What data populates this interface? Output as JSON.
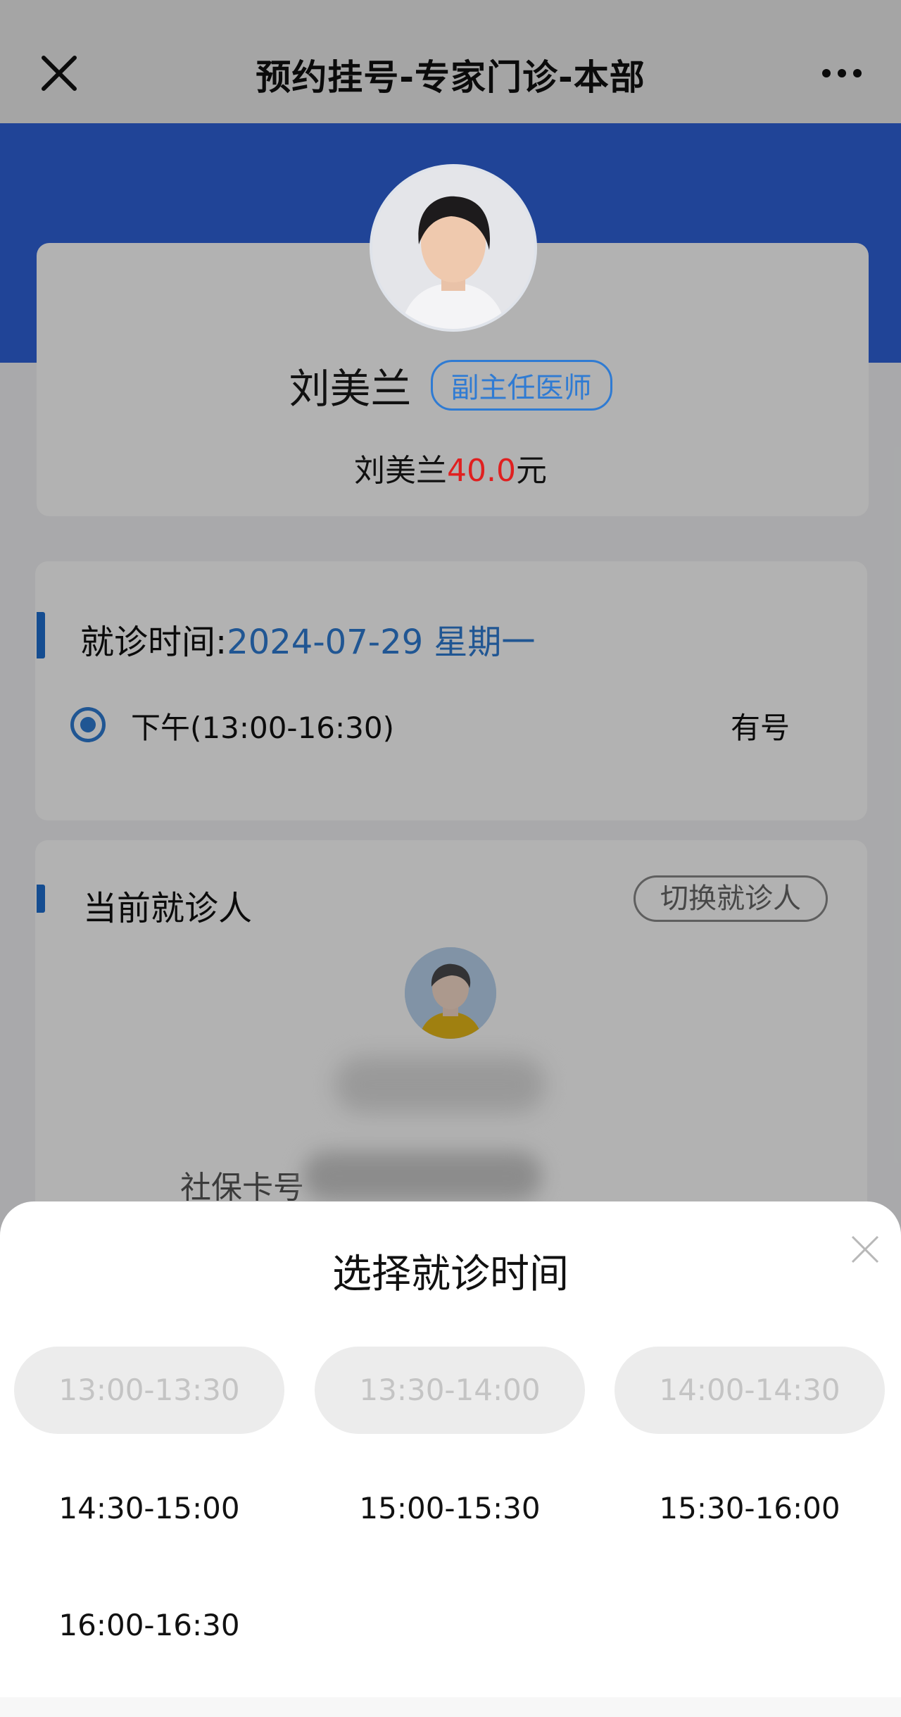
{
  "header": {
    "title": "预约挂号-专家门诊-本部",
    "close_icon": "close-icon",
    "more_icon": "more-icon"
  },
  "doctor": {
    "name": "刘美兰",
    "title": "副主任医师",
    "fee_prefix": "刘美兰",
    "fee_amount": "40.0",
    "fee_unit": "元"
  },
  "visit": {
    "label": "就诊时间:",
    "date": "2024-07-29 星期一",
    "slot": "下午(13:00-16:30)",
    "slot_status": "有号"
  },
  "patient": {
    "label": "当前就诊人",
    "switch_label": "切换就诊人",
    "card_label": "社保卡号"
  },
  "sheet": {
    "title": "选择就诊时间",
    "slots": [
      {
        "label": "13:00-13:30",
        "disabled": true
      },
      {
        "label": "13:30-14:00",
        "disabled": true
      },
      {
        "label": "14:00-14:30",
        "disabled": true
      },
      {
        "label": "14:30-15:00",
        "disabled": false
      },
      {
        "label": "15:00-15:30",
        "disabled": false
      },
      {
        "label": "15:30-16:00",
        "disabled": false
      },
      {
        "label": "16:00-16:30",
        "disabled": false
      }
    ]
  },
  "colors": {
    "accent": "#2f7bd3",
    "brand_band": "#2e62d9",
    "price": "#e02020"
  }
}
